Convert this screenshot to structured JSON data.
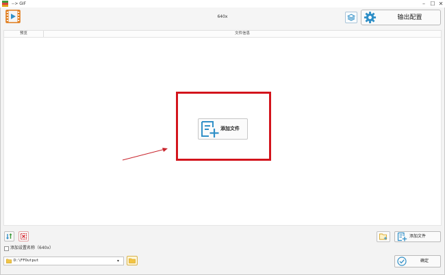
{
  "window": {
    "title": "--> GIF",
    "controls": [
      "–",
      "☐",
      "✕"
    ]
  },
  "header": {
    "center_title": "640x",
    "output_config_label": "输出配置"
  },
  "table": {
    "columns": [
      "预览",
      "文件信息"
    ]
  },
  "main": {
    "add_file_label": "添加文件"
  },
  "footer": {
    "add_file_label": "添加文件",
    "checkbox_label": "添加设置名称（640x）",
    "checkbox_checked": false,
    "output_path": "D:\\FFOutput",
    "confirm_label": "确定"
  },
  "colors": {
    "accent": "#2f8fc7",
    "highlight": "#d3141c",
    "film_icon": "#e07b1a"
  }
}
